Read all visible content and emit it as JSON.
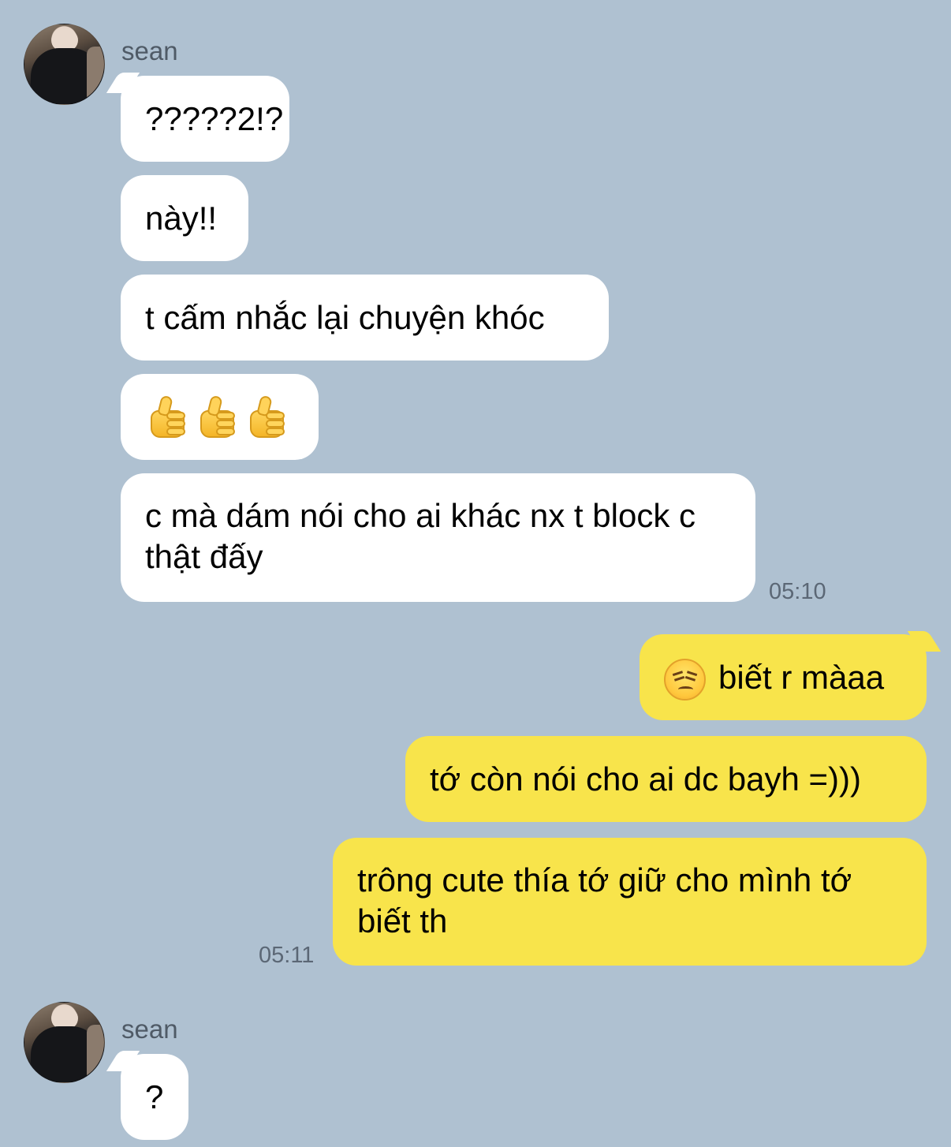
{
  "chat": {
    "sender_name": "sean",
    "messages": {
      "m1": "?????2!?",
      "m2": "này!!",
      "m3": "t cấm nhắc lại chuyện khóc",
      "m4": "👍👍👍",
      "m5": "c mà dám nói cho ai khác nx t block c thật đấy",
      "m6": "biết r màaa",
      "m7": "tớ còn nói cho ai dc bayh =)))",
      "m8": "trông cute thía tớ giữ cho mình tớ biết th",
      "m9": "?"
    },
    "timestamps": {
      "t1": "05:10",
      "t2": "05:11"
    },
    "icons": {
      "avatar": "profile-photo",
      "thumbs": "thumbs-up-emoji",
      "persevere": "persevering-face-emoji"
    }
  },
  "colors": {
    "background": "#afc1d1",
    "incoming_bubble": "#ffffff",
    "outgoing_bubble": "#f8e44b",
    "timestamp": "#5b6775"
  }
}
